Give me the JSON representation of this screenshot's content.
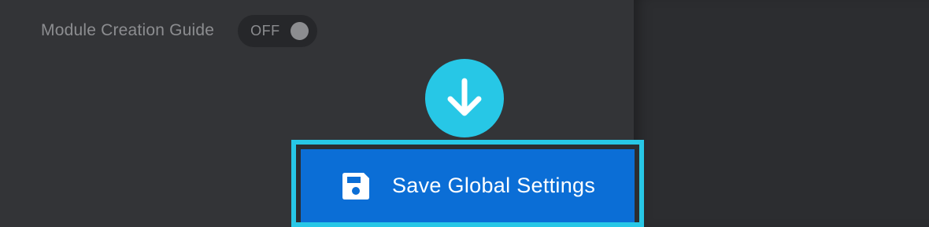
{
  "settings": {
    "module_creation_guide": {
      "label": "Module Creation Guide",
      "toggle_state_text": "OFF"
    }
  },
  "actions": {
    "save_global_settings_label": "Save Global Settings"
  },
  "icons": {
    "arrow": "arrow-down-icon",
    "save": "floppy-disk-icon"
  },
  "colors": {
    "accent": "#27c7e6",
    "button": "#0b6ed6",
    "panel": "#333437",
    "background": "#2c2d30",
    "muted_text": "#8c8d90"
  }
}
